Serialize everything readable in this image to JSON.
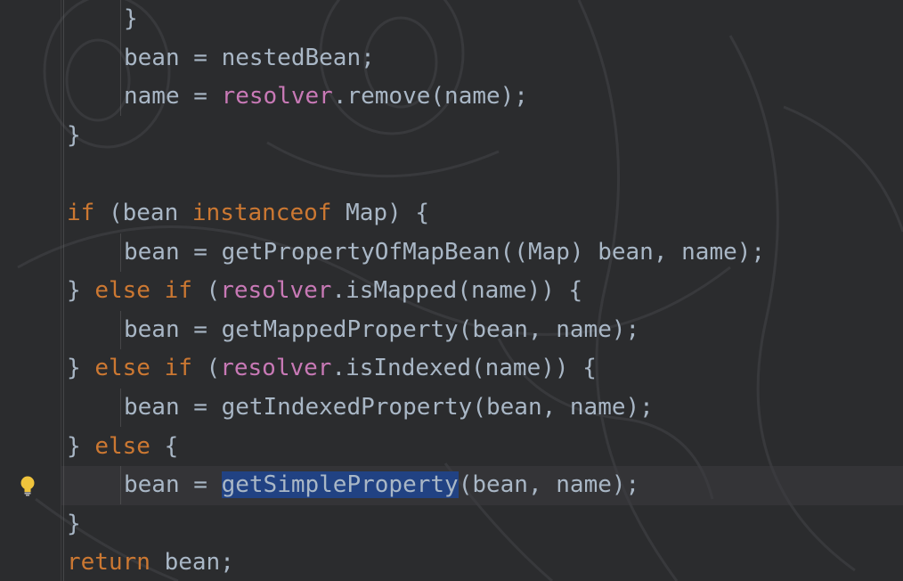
{
  "lines": [
    {
      "indent": 3,
      "tokens": [
        {
          "t": "}",
          "c": "plain"
        }
      ]
    },
    {
      "indent": 3,
      "tokens": [
        {
          "t": "bean = nestedBean;",
          "c": "plain"
        }
      ]
    },
    {
      "indent": 3,
      "tokens": [
        {
          "t": "name = ",
          "c": "plain"
        },
        {
          "t": "resolver",
          "c": "fld"
        },
        {
          "t": ".remove(name);",
          "c": "plain"
        }
      ]
    },
    {
      "indent": 2,
      "tokens": [
        {
          "t": "}",
          "c": "plain"
        }
      ]
    },
    {
      "indent": 2,
      "tokens": []
    },
    {
      "indent": 2,
      "tokens": [
        {
          "t": "if",
          "c": "kw"
        },
        {
          "t": " (bean ",
          "c": "plain"
        },
        {
          "t": "instanceof",
          "c": "kw"
        },
        {
          "t": " Map) {",
          "c": "plain"
        }
      ]
    },
    {
      "indent": 3,
      "tokens": [
        {
          "t": "bean = getPropertyOfMapBean((Map) bean, name);",
          "c": "plain"
        }
      ]
    },
    {
      "indent": 2,
      "tokens": [
        {
          "t": "} ",
          "c": "plain"
        },
        {
          "t": "else if",
          "c": "kw"
        },
        {
          "t": " (",
          "c": "plain"
        },
        {
          "t": "resolver",
          "c": "fld"
        },
        {
          "t": ".isMapped(name)) {",
          "c": "plain"
        }
      ]
    },
    {
      "indent": 3,
      "tokens": [
        {
          "t": "bean = getMappedProperty(bean, name);",
          "c": "plain"
        }
      ]
    },
    {
      "indent": 2,
      "tokens": [
        {
          "t": "} ",
          "c": "plain"
        },
        {
          "t": "else if",
          "c": "kw"
        },
        {
          "t": " (",
          "c": "plain"
        },
        {
          "t": "resolver",
          "c": "fld"
        },
        {
          "t": ".isIndexed(name)) {",
          "c": "plain"
        }
      ]
    },
    {
      "indent": 3,
      "tokens": [
        {
          "t": "bean = getIndexedProperty(bean, name);",
          "c": "plain"
        }
      ]
    },
    {
      "indent": 2,
      "tokens": [
        {
          "t": "} ",
          "c": "plain"
        },
        {
          "t": "else",
          "c": "kw"
        },
        {
          "t": " {",
          "c": "plain"
        }
      ]
    },
    {
      "indent": 3,
      "tokens": [
        {
          "t": "bean = ",
          "c": "plain"
        },
        {
          "t": "getSimpleProperty",
          "c": "sel"
        },
        {
          "t": "(bean, name);",
          "c": "plain"
        }
      ]
    },
    {
      "indent": 2,
      "tokens": [
        {
          "t": "}",
          "c": "plain"
        }
      ]
    },
    {
      "indent": 2,
      "tokens": [
        {
          "t": "return",
          "c": "kw"
        },
        {
          "t": " bean;",
          "c": "plain"
        }
      ]
    }
  ],
  "caret_line_index": 12,
  "gutter_icon": "lightbulb-icon",
  "colors": {
    "background": "#2b2c2e",
    "text": "#a9b7c6",
    "keyword": "#cc7832",
    "field": "#c879b6",
    "selection": "#214283",
    "bulb": "#f0c43c"
  }
}
